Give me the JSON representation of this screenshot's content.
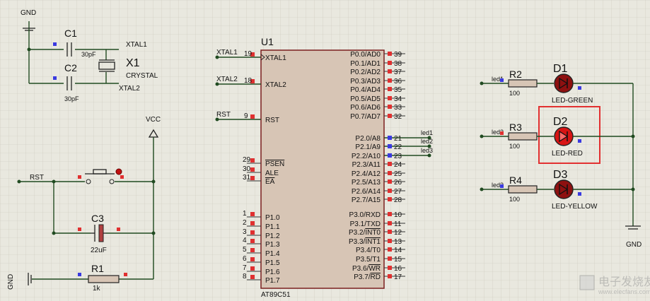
{
  "power": {
    "gnd_top": "GND",
    "gnd_left": "GND",
    "gnd_right": "GND",
    "vcc": "VCC"
  },
  "crystal": {
    "c1_ref": "C1",
    "c1_value": "30pF",
    "c2_ref": "C2",
    "c2_value": "30pF",
    "x1_ref": "X1",
    "x1_type": "CRYSTAL",
    "net_xtal1": "XTAL1",
    "net_xtal2": "XTAL2"
  },
  "reset": {
    "net_rst": "RST",
    "c3_ref": "C3",
    "c3_value": "22uF",
    "r1_ref": "R1",
    "r1_value": "1k"
  },
  "mcu": {
    "ref": "U1",
    "part": "AT89C51",
    "left_pins": [
      {
        "num": "19",
        "name": "XTAL1",
        "net": "XTAL1"
      },
      {
        "num": "18",
        "name": "XTAL2",
        "net": "XTAL2"
      },
      {
        "num": "9",
        "name": "RST",
        "net": "RST"
      },
      {
        "num": "29",
        "name": "PSEN",
        "overline": true
      },
      {
        "num": "30",
        "name": "ALE"
      },
      {
        "num": "31",
        "name": "EA",
        "overline": true
      },
      {
        "num": "1",
        "name": "P1.0"
      },
      {
        "num": "2",
        "name": "P1.1"
      },
      {
        "num": "3",
        "name": "P1.2"
      },
      {
        "num": "4",
        "name": "P1.3"
      },
      {
        "num": "5",
        "name": "P1.4"
      },
      {
        "num": "6",
        "name": "P1.5"
      },
      {
        "num": "7",
        "name": "P1.6"
      },
      {
        "num": "8",
        "name": "P1.7"
      }
    ],
    "right_pins": [
      {
        "num": "39",
        "name": "P0.0/AD0"
      },
      {
        "num": "38",
        "name": "P0.1/AD1"
      },
      {
        "num": "37",
        "name": "P0.2/AD2"
      },
      {
        "num": "36",
        "name": "P0.3/AD3"
      },
      {
        "num": "35",
        "name": "P0.4/AD4"
      },
      {
        "num": "34",
        "name": "P0.5/AD5"
      },
      {
        "num": "33",
        "name": "P0.6/AD6"
      },
      {
        "num": "32",
        "name": "P0.7/AD7"
      },
      {
        "num": "21",
        "name": "P2.0/A8",
        "net": "led1"
      },
      {
        "num": "22",
        "name": "P2.1/A9",
        "net": "led2"
      },
      {
        "num": "23",
        "name": "P2.2/A10",
        "net": "led3"
      },
      {
        "num": "24",
        "name": "P2.3/A11"
      },
      {
        "num": "25",
        "name": "P2.4/A12"
      },
      {
        "num": "26",
        "name": "P2.5/A13"
      },
      {
        "num": "27",
        "name": "P2.6/A14"
      },
      {
        "num": "28",
        "name": "P2.7/A15"
      },
      {
        "num": "10",
        "name": "P3.0/RXD"
      },
      {
        "num": "11",
        "name": "P3.1/TXD"
      },
      {
        "num": "12",
        "name": "P3.2/INT0",
        "over_part": "INT0"
      },
      {
        "num": "13",
        "name": "P3.3/INT1",
        "over_part": "INT1"
      },
      {
        "num": "14",
        "name": "P3.4/T0"
      },
      {
        "num": "15",
        "name": "P3.5/T1"
      },
      {
        "num": "16",
        "name": "P3.6/WR",
        "over_part": "WR"
      },
      {
        "num": "17",
        "name": "P3.7/RD",
        "over_part": "RD"
      }
    ]
  },
  "leds": [
    {
      "net": "led1",
      "r_ref": "R2",
      "r_value": "100",
      "d_ref": "D1",
      "d_type": "LED-GREEN",
      "lit": false
    },
    {
      "net": "led2",
      "r_ref": "R3",
      "r_value": "100",
      "d_ref": "D2",
      "d_type": "LED-RED",
      "lit": true
    },
    {
      "net": "led3",
      "r_ref": "R4",
      "r_value": "100",
      "d_ref": "D3",
      "d_type": "LED-YELLOW",
      "lit": false
    }
  ],
  "watermark": {
    "text_cn": "电子发烧友",
    "text_url": "www.elecfans.com"
  },
  "colors": {
    "background": "#e9e8df",
    "grid": "#c9c7ba",
    "wire": "#214b21",
    "chip_fill": "#d7c5b5",
    "chip_border": "#7a1e1e",
    "resistor_fill": "#d7c5b5",
    "led_body": "#8e1010",
    "led_lit": "#d81414",
    "highlight": "#e23030",
    "pin_high": "#e03030",
    "pin_low": "#3a3ae0"
  }
}
